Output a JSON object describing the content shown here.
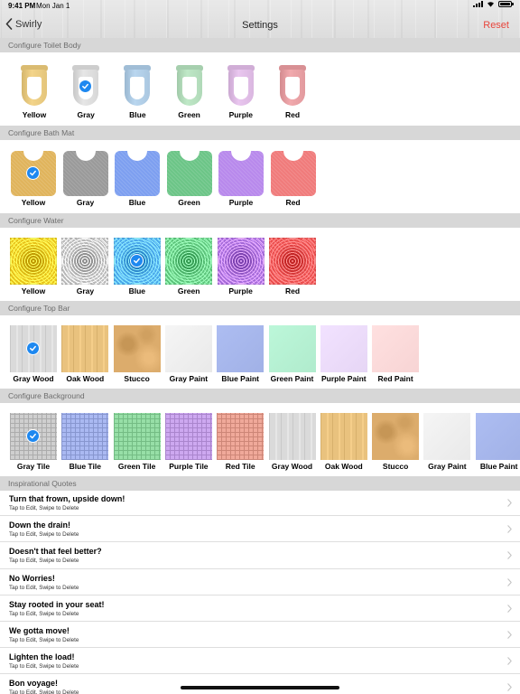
{
  "status": {
    "time": "9:41 PM",
    "date": "Mon Jan 1"
  },
  "nav": {
    "back_label": "Swirly",
    "title": "Settings",
    "reset_label": "Reset"
  },
  "sections": {
    "toilet": "Configure Toilet Body",
    "mat": "Configure Bath Mat",
    "water": "Configure Water",
    "topbar": "Configure Top Bar",
    "background": "Configure Background",
    "quotes": "Inspirational Quotes"
  },
  "toilet_options": [
    {
      "label": "Yellow",
      "color": "#f3d48a",
      "selected": false
    },
    {
      "label": "Gray",
      "color": "#e6e6e6",
      "selected": true
    },
    {
      "label": "Blue",
      "color": "#b9d6ef",
      "selected": false
    },
    {
      "label": "Green",
      "color": "#bfe8c7",
      "selected": false
    },
    {
      "label": "Purple",
      "color": "#e9c6ef",
      "selected": false
    },
    {
      "label": "Red",
      "color": "#f1a9ad",
      "selected": false
    }
  ],
  "mat_options": [
    {
      "label": "Yellow",
      "color": "#e0b45c",
      "selected": true
    },
    {
      "label": "Gray",
      "color": "#9a9a9a",
      "selected": false
    },
    {
      "label": "Blue",
      "color": "#7d9ff0",
      "selected": false
    },
    {
      "label": "Green",
      "color": "#6cc587",
      "selected": false
    },
    {
      "label": "Purple",
      "color": "#b889ec",
      "selected": false
    },
    {
      "label": "Red",
      "color": "#f07b7b",
      "selected": false
    }
  ],
  "water_options": [
    {
      "label": "Yellow",
      "color": "#e8c21a",
      "selected": false
    },
    {
      "label": "Gray",
      "color": "#b8b8b8",
      "selected": false
    },
    {
      "label": "Blue",
      "color": "#4aa7ea",
      "selected": true
    },
    {
      "label": "Green",
      "color": "#5ec47c",
      "selected": false
    },
    {
      "label": "Purple",
      "color": "#a46ad8",
      "selected": false
    },
    {
      "label": "Red",
      "color": "#ea4c4c",
      "selected": false
    }
  ],
  "topbar_options": [
    {
      "label": "Gray Wood",
      "color": "#dadada",
      "pattern": "wood",
      "selected": true
    },
    {
      "label": "Oak Wood",
      "color": "#e9c27e",
      "pattern": "wood",
      "selected": false
    },
    {
      "label": "Stucco",
      "color": "#dcac6c",
      "pattern": "stucco",
      "selected": false
    },
    {
      "label": "Gray Paint",
      "color": "#efefef",
      "pattern": "paint",
      "selected": false
    },
    {
      "label": "Blue Paint",
      "color": "#a7b7ec",
      "pattern": "paint",
      "selected": false
    },
    {
      "label": "Green Paint",
      "color": "#b6f1d3",
      "pattern": "paint",
      "selected": false
    },
    {
      "label": "Purple Paint",
      "color": "#ecdcfb",
      "pattern": "paint",
      "selected": false
    },
    {
      "label": "Red Paint",
      "color": "#fddada",
      "pattern": "paint",
      "selected": false
    }
  ],
  "background_options": [
    {
      "label": "Gray Tile",
      "color": "#cfcfcf",
      "pattern": "tile",
      "selected": true
    },
    {
      "label": "Blue Tile",
      "color": "#aab9f2",
      "pattern": "tile",
      "selected": false
    },
    {
      "label": "Green Tile",
      "color": "#97dfa7",
      "pattern": "tile",
      "selected": false
    },
    {
      "label": "Purple Tile",
      "color": "#cda8f0",
      "pattern": "tile",
      "selected": false
    },
    {
      "label": "Red Tile",
      "color": "#f0a99a",
      "pattern": "tile",
      "selected": false
    },
    {
      "label": "Gray Wood",
      "color": "#dadada",
      "pattern": "wood",
      "selected": false
    },
    {
      "label": "Oak Wood",
      "color": "#e9c27e",
      "pattern": "wood",
      "selected": false
    },
    {
      "label": "Stucco",
      "color": "#dcac6c",
      "pattern": "stucco",
      "selected": false
    },
    {
      "label": "Gray Paint",
      "color": "#efefef",
      "pattern": "paint",
      "selected": false
    },
    {
      "label": "Blue Paint",
      "color": "#a7b7ec",
      "pattern": "paint",
      "selected": false
    }
  ],
  "quotes": [
    {
      "title": "Turn that frown, upside down!",
      "subtitle": "Tap to Edit, Swipe to Delete"
    },
    {
      "title": "Down the drain!",
      "subtitle": "Tap to Edit, Swipe to Delete"
    },
    {
      "title": "Doesn't that feel better?",
      "subtitle": "Tap to Edit, Swipe to Delete"
    },
    {
      "title": "No Worries!",
      "subtitle": "Tap to Edit, Swipe to Delete"
    },
    {
      "title": "Stay rooted in your seat!",
      "subtitle": "Tap to Edit, Swipe to Delete"
    },
    {
      "title": "We gotta move!",
      "subtitle": "Tap to Edit, Swipe to Delete"
    },
    {
      "title": "Lighten the load!",
      "subtitle": "Tap to Edit, Swipe to Delete"
    },
    {
      "title": "Bon voyage!",
      "subtitle": "Tap to Edit, Swipe to Delete"
    }
  ]
}
